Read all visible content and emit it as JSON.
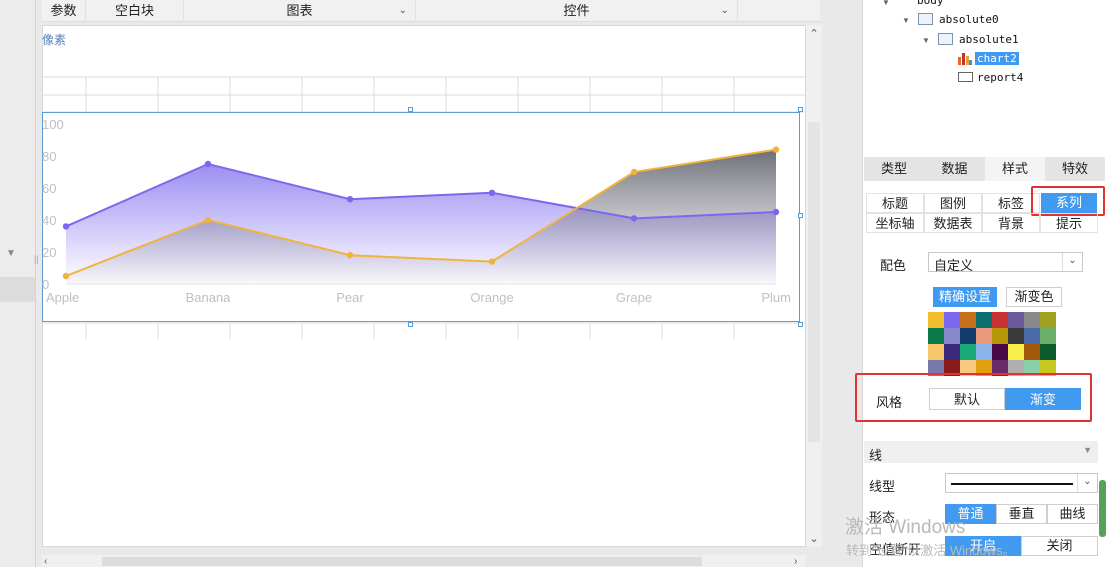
{
  "toolbar": {
    "params": "参数",
    "blank_block": "空白块",
    "chart": "图表",
    "control": "控件"
  },
  "canvas": {
    "pixel_label": "像素"
  },
  "chart_data": {
    "type": "area",
    "categories": [
      "Apple",
      "Banana",
      "Pear",
      "Orange",
      "Grape",
      "Plum"
    ],
    "series": [
      {
        "values": [
          36,
          75,
          53,
          57,
          41,
          45
        ],
        "color": "#7b68ee"
      },
      {
        "values": [
          5,
          40,
          18,
          14,
          70,
          84
        ],
        "color": "#f0b43c"
      }
    ],
    "yticks": [
      "0",
      "20",
      "40",
      "60",
      "80",
      "100"
    ],
    "ylim": [
      0,
      100
    ],
    "style": "gradient"
  },
  "tree": {
    "body": "body",
    "absolute0": "absolute0",
    "absolute1": "absolute1",
    "chart2": "chart2",
    "report4": "report4"
  },
  "panel": {
    "tabs": [
      "类型",
      "数据",
      "样式",
      "特效"
    ],
    "subtabs_row1": [
      "标题",
      "图例",
      "标签",
      "系列"
    ],
    "subtabs_row2": [
      "坐标轴",
      "数据表",
      "背景",
      "提示"
    ],
    "color_scheme_label": "配色",
    "color_scheme_value": "自定义",
    "precise_settings": "精确设置",
    "gradient_color": "渐变色",
    "palette": [
      "#f2be2e",
      "#7b68ee",
      "#c6711a",
      "#0a6e6e",
      "#c83232",
      "#6a5a9a",
      "#888888",
      "#a0a020",
      "#0a7a4a",
      "#8888cc",
      "#123a6a",
      "#e89a7a",
      "#b8960a",
      "#3a3a3a",
      "#4a6aaa",
      "#6ab06a",
      "#f8c86a",
      "#3a2a7a",
      "#1aaa7a",
      "#8ab4ea",
      "#4a0a4a",
      "#f8f04a",
      "#a05a0a",
      "#0a5a2a",
      "#7a7aaa",
      "#8a1a1a",
      "#f8c880",
      "#e0a010",
      "#6a2a6a",
      "#b0b0b0",
      "#8ad0aa",
      "#c8c820"
    ],
    "style_label": "风格",
    "style_default": "默认",
    "style_gradient": "渐变",
    "line_section": "线",
    "line_type_label": "线型",
    "shape_label": "形态",
    "shape_normal": "普通",
    "shape_vertical": "垂直",
    "shape_curve": "曲线",
    "null_break_label": "空值断开",
    "null_on": "开启",
    "null_off": "关闭"
  },
  "watermark": {
    "line1": "激活 Windows",
    "line2": "转到\"设置\"以激活 Windows。"
  }
}
